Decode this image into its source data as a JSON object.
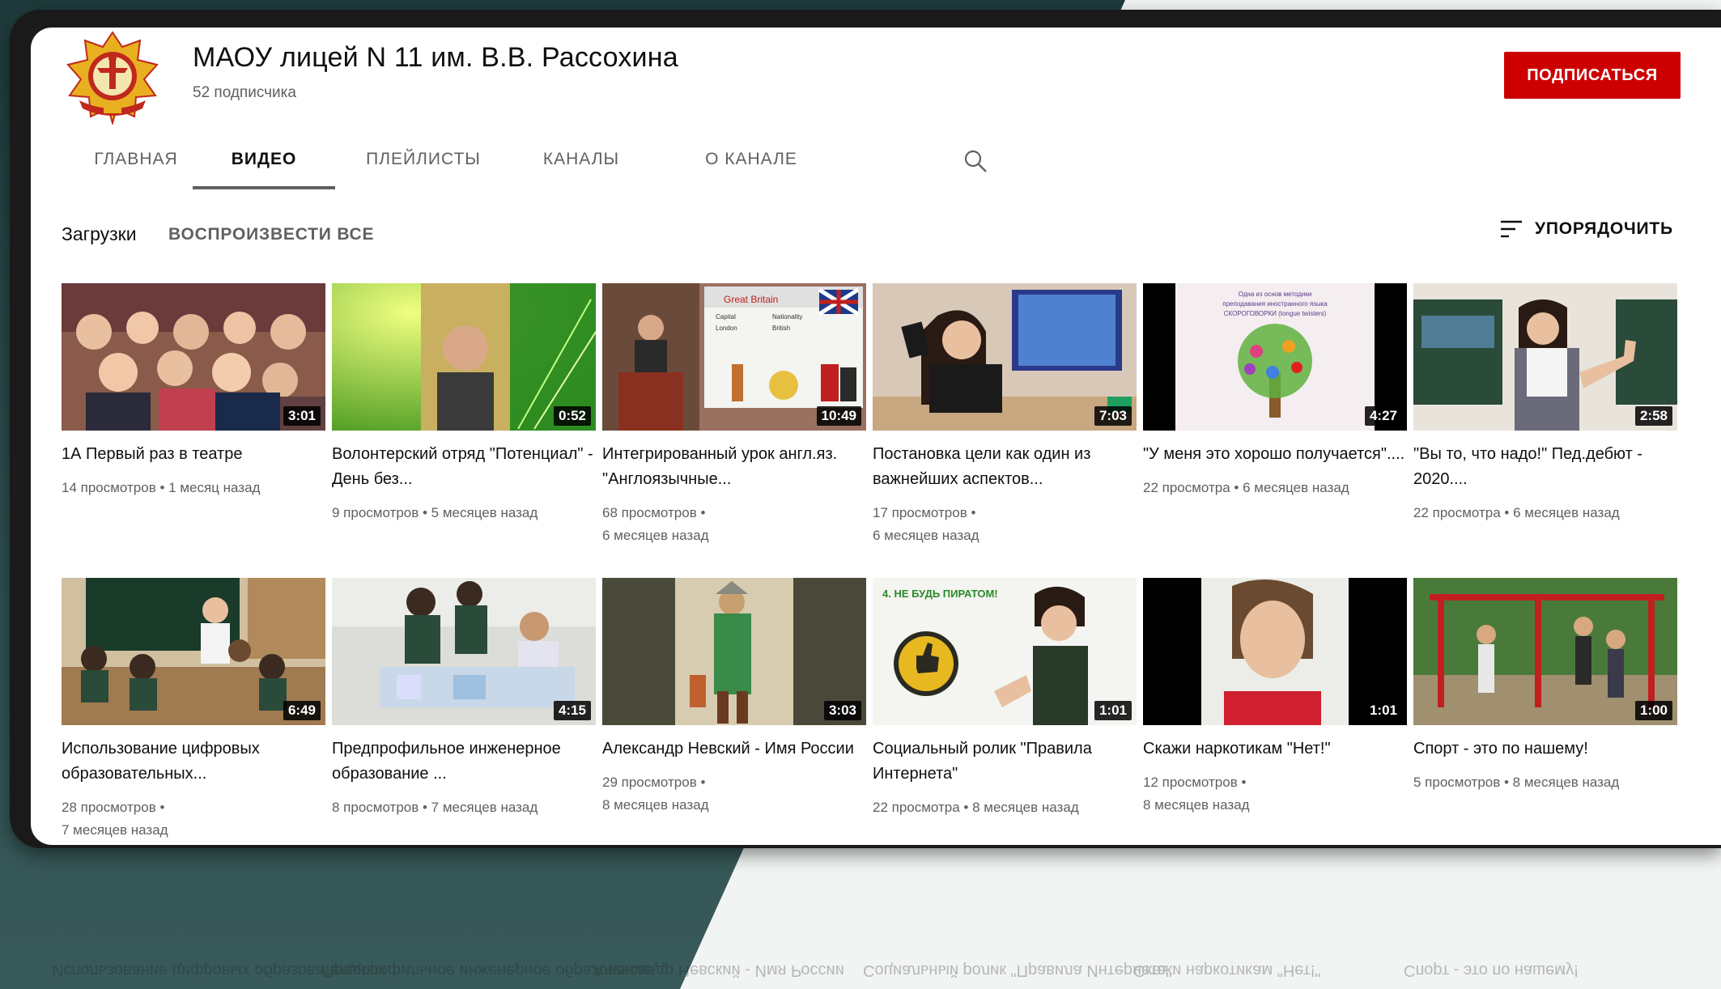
{
  "channel": {
    "name": "МАОУ лицей N 11 им. В.В. Рассохина",
    "subscribers": "52 подписчика",
    "subscribe_label": "ПОДПИСАТЬСЯ"
  },
  "tabs": [
    {
      "label": "ГЛАВНАЯ"
    },
    {
      "label": "ВИДЕО"
    },
    {
      "label": "ПЛЕЙЛИСТЫ"
    },
    {
      "label": "КАНАЛЫ"
    },
    {
      "label": "О КАНАЛЕ"
    }
  ],
  "active_tab": "ВИДЕО",
  "section": {
    "title": "Загрузки",
    "play_all": "ВОСПРОИЗВЕСТИ ВСЕ",
    "sort_label": "УПОРЯДОЧИТЬ"
  },
  "videos": [
    {
      "title": "1А Первый раз в театре",
      "meta": "14 просмотров • 1 месяц назад",
      "duration": "3:01"
    },
    {
      "title": "Волонтерский отряд \"Потенциал\" - День без...",
      "meta": "9 просмотров • 5 месяцев назад",
      "duration": "0:52"
    },
    {
      "title": "Интегрированный урок англ.яз. \"Англоязычные...",
      "meta": "68 просмотров •\n6 месяцев назад",
      "duration": "10:49"
    },
    {
      "title": "Постановка цели как один из важнейших аспектов...",
      "meta": "17 просмотров •\n6 месяцев назад",
      "duration": "7:03"
    },
    {
      "title": "\"У меня это хорошо получается\"....",
      "meta": "22 просмотра • 6 месяцев назад",
      "duration": "4:27"
    },
    {
      "title": "\"Вы то, что надо!\" Пед.дебют - 2020....",
      "meta": "22 просмотра • 6 месяцев назад",
      "duration": "2:58"
    },
    {
      "title": "Использование цифровых образовательных...",
      "meta": "28 просмотров •\n7 месяцев назад",
      "duration": "6:49"
    },
    {
      "title": "Предпрофильное инженерное образование ...",
      "meta": "8 просмотров • 7 месяцев назад",
      "duration": "4:15"
    },
    {
      "title": "Александр Невский - Имя России",
      "meta": "29 просмотров •\n8 месяцев назад",
      "duration": "3:03"
    },
    {
      "title": "Социальный ролик \"Правила Интернета\"",
      "meta": "22 просмотра • 8 месяцев назад",
      "duration": "1:01"
    },
    {
      "title": "Скажи наркотикам \"Нет!\"",
      "meta": "12 просмотров •\n8 месяцев назад",
      "duration": "1:01"
    },
    {
      "title": "Спорт - это по нашему!",
      "meta": "5 просмотров • 8 месяцев назад",
      "duration": "1:00"
    }
  ],
  "thumb_text": {
    "great_britain": "Great Britain",
    "capital": "Capital",
    "nationality": "Nationality",
    "london": "London",
    "british": "British",
    "ne_bud_piratom": "4. НЕ БУДЬ ПИРАТОМ!",
    "skorogovorki_1": "Одна из основ методики",
    "skorogovorki_2": "преподавания иностранного языка",
    "skorogovorki_3": "СКОРОГОВОРКИ (tongue twisters)"
  },
  "colors": {
    "subscribe": "#cc0000",
    "text_primary": "#0f0f0f",
    "text_secondary": "#606060",
    "background_dark": "#2c4a4a"
  },
  "icons": {
    "search": "search-icon",
    "sort": "sort-icon",
    "logo": "lyceum-logo"
  }
}
